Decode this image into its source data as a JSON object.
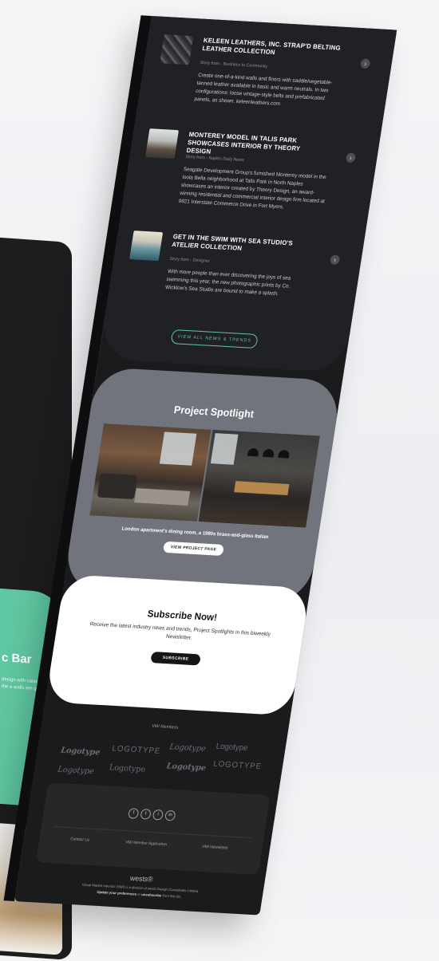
{
  "news": {
    "items": [
      {
        "title": "KELEEN LEATHERS, INC. STRAP'D BELTING LEATHER COLLECTION",
        "source": "Story from - Business to Community",
        "body": "Create one-of-a-kind walls and floors with saddle/vegetable-tanned leather available in basic and warm neutrals. In two configurations: loose vintage-style belts and prefabricated panels, as shown. keleenleathers.com"
      },
      {
        "title": "MONTEREY MODEL IN TALIS PARK SHOWCASES INTERIOR BY THEORY DESIGN",
        "source": "Story from - Naples Daily News",
        "body": "Seagate Development Group's furnished Monterey model in the Isola Bella neighborhood at Talis Park in North Naples showcases an interior created by Theory Design, an award-winning residential and commercial interior design firm located at 9921 Interstate Commerce Drive in Fort Myers."
      },
      {
        "title": "GET IN THE SWIM WITH SEA STUDIO'S ATELIER COLLECTION",
        "source": "Story from - Designer",
        "body": "With more people than ever discovering the joys of sea swimming this year, the new photographic prints by Co. Wicklow's Sea Studio are bound to make a splash."
      }
    ],
    "view_all_label": "VIEW ALL NEWS & TRENDS"
  },
  "spotlight": {
    "title": "Project Spotlight",
    "caption": "London apartment's dining room, a 1980s brass-and-glass Italian",
    "button_label": "VIEW PROJECT PAGE"
  },
  "subscribe": {
    "title": "Subscribe Now!",
    "text": "Receive the latest industry news and trends, Project Spotlights in this biweekly Newsletter.",
    "button_label": "SUBSCRIBE"
  },
  "members": {
    "title": "VMI Members",
    "logos": [
      "Logotype",
      "LOGOTYPE",
      "Logotype",
      "Logotype",
      "Logotype",
      "Logotype",
      "Logotype",
      "LOGOTYPE"
    ]
  },
  "footer": {
    "social": [
      "f",
      "t",
      "i",
      "in"
    ],
    "links": [
      "Contact Us",
      "VMI Member Application",
      "VMI Newsletter"
    ],
    "brand": "wests®",
    "fine1": "Visual Market Interiors (VMI) is a division of wests Design Consultants Limited",
    "fine2_pre": "Update your preferences",
    "fine2_mid": " or ",
    "fine2_post": "unsubscribe",
    "fine2_end": " from this list."
  },
  "left_card": {
    "title": "c Bar",
    "text": "design with cated in the e walls are g grey."
  },
  "colors": {
    "accent": "#5fc7a1",
    "dark": "#1a1b1d",
    "spotlight": "#71747c"
  }
}
